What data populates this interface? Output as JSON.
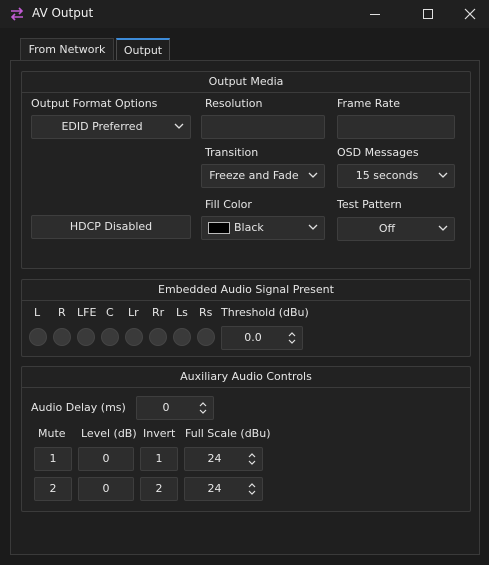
{
  "window": {
    "title": "AV Output",
    "icon": "swap-arrows-icon",
    "accent": "#c15bd3"
  },
  "tabs": [
    "From Network",
    "Output"
  ],
  "output_media": {
    "title": "Output Media",
    "format_label": "Output Format Options",
    "format_value": "EDID Preferred",
    "resolution_label": "Resolution",
    "resolution_value": "",
    "frame_rate_label": "Frame Rate",
    "frame_rate_value": "",
    "transition_label": "Transition",
    "transition_value": "Freeze and Fade",
    "osd_label": "OSD Messages",
    "osd_value": "15 seconds",
    "hdcp_label": "HDCP Disabled",
    "fill_color_label": "Fill Color",
    "fill_color_value": "Black",
    "test_pattern_label": "Test Pattern",
    "test_pattern_value": "Off"
  },
  "embedded_audio": {
    "title": "Embedded Audio Signal Present",
    "channels": [
      "L",
      "R",
      "LFE",
      "C",
      "Lr",
      "Rr",
      "Ls",
      "Rs"
    ],
    "threshold_label": "Threshold (dBu)",
    "threshold_value": "0.0"
  },
  "aux_audio": {
    "title": "Auxiliary Audio Controls",
    "delay_label": "Audio Delay (ms)",
    "delay_value": "0",
    "headers": [
      "Mute",
      "Level (dB)",
      "Invert",
      "Full Scale (dBu)"
    ],
    "rows": [
      {
        "mute": "1",
        "level": "0",
        "invert": "1",
        "full_scale": "24"
      },
      {
        "mute": "2",
        "level": "0",
        "invert": "2",
        "full_scale": "24"
      }
    ]
  }
}
